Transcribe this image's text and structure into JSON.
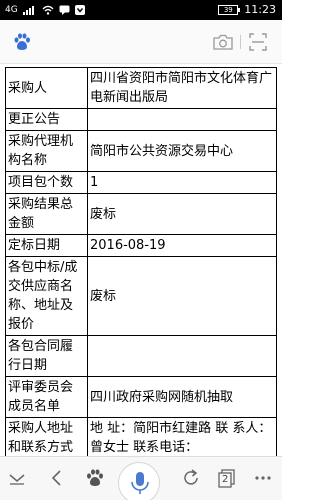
{
  "status_bar": {
    "network": "4G",
    "battery": "39",
    "time": "11:23"
  },
  "header": {
    "logo_icon": "baidu-paw-icon",
    "camera_icon": "camera-icon",
    "scan_icon": "scan-icon"
  },
  "table": {
    "rows": [
      {
        "key": "采购人",
        "value": "四川省资阳市简阳市文化体育广电新闻出版局"
      },
      {
        "key": "更正公告",
        "value": ""
      },
      {
        "key": "采购代理机构名称",
        "value": "简阳市公共资源交易中心"
      },
      {
        "key": "项目包个数",
        "value": "1"
      },
      {
        "key": "采购结果总金额",
        "value": "废标"
      },
      {
        "key": "定标日期",
        "value": "2016-08-19"
      },
      {
        "key": "各包中标/成交供应商名称、地址及报价",
        "value": "废标"
      },
      {
        "key": "各包合同履行日期",
        "value": ""
      },
      {
        "key": "评审委员会成员名单",
        "value": "四川政府采购网随机抽取"
      },
      {
        "key": "采购人地址和联系方式",
        "value": "地 址：简阳市红建路 联 系人： 曾女士 联系电话："
      }
    ]
  },
  "bottom_bar": {
    "tab_count": "2",
    "icons": [
      "collapse-icon",
      "back-icon",
      "baidu-home-icon",
      "mic-icon",
      "refresh-icon",
      "tabs-icon",
      "menu-icon"
    ]
  },
  "colors": {
    "status_bg": "#000000",
    "header_bg": "#fafafa",
    "mic_blue": "#4a7bd0"
  }
}
